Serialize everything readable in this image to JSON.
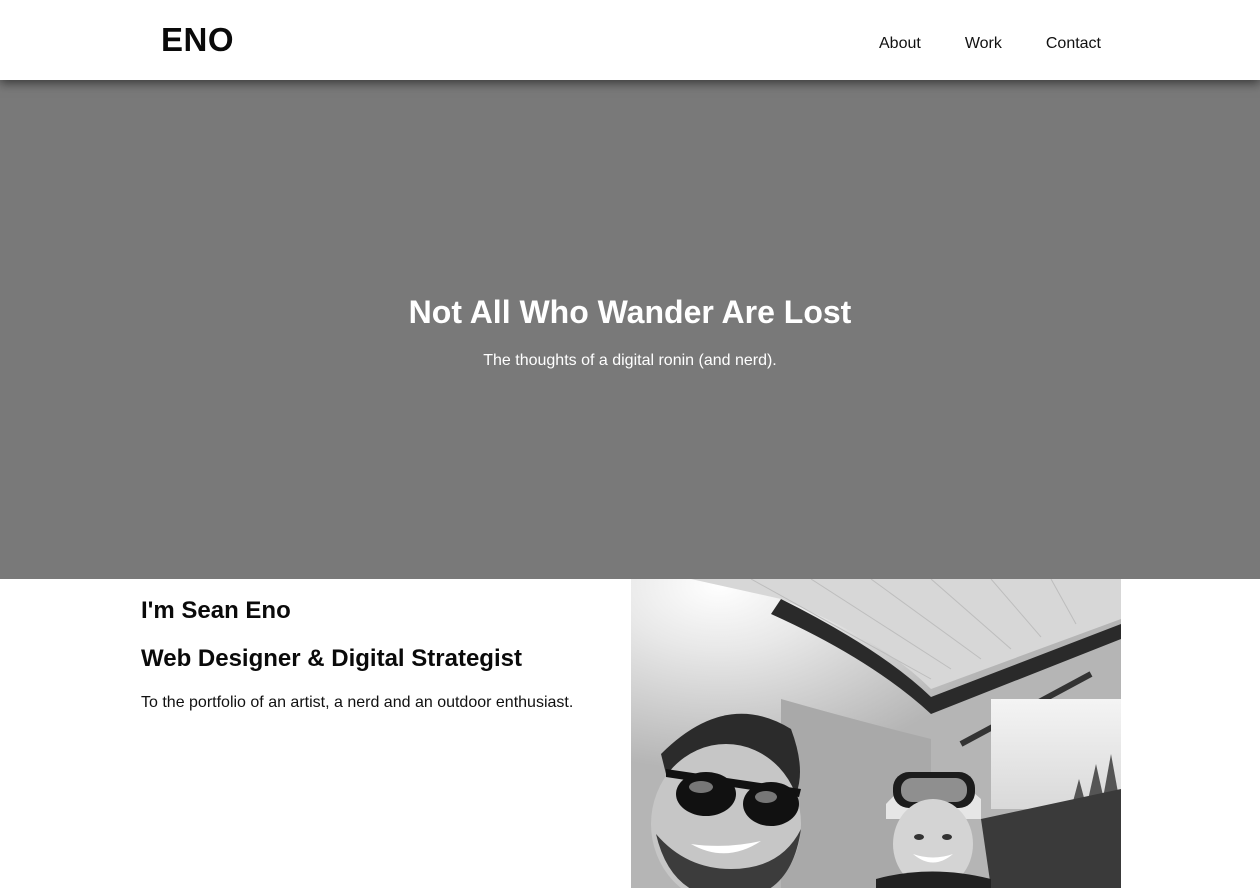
{
  "header": {
    "logo": "ENO",
    "nav": [
      "About",
      "Work",
      "Contact"
    ]
  },
  "hero": {
    "title": "Not All Who Wander Are Lost",
    "subtitle": "The thoughts of a digital ronin (and nerd)."
  },
  "intro": {
    "name": "I'm Sean Eno",
    "role": "Web Designer & Digital Strategist",
    "tagline": "To the portfolio of an artist, a nerd and an outdoor enthusiast."
  },
  "colors": {
    "hero_background": "#797979",
    "header_background": "#ffffff",
    "text": "#111111"
  }
}
